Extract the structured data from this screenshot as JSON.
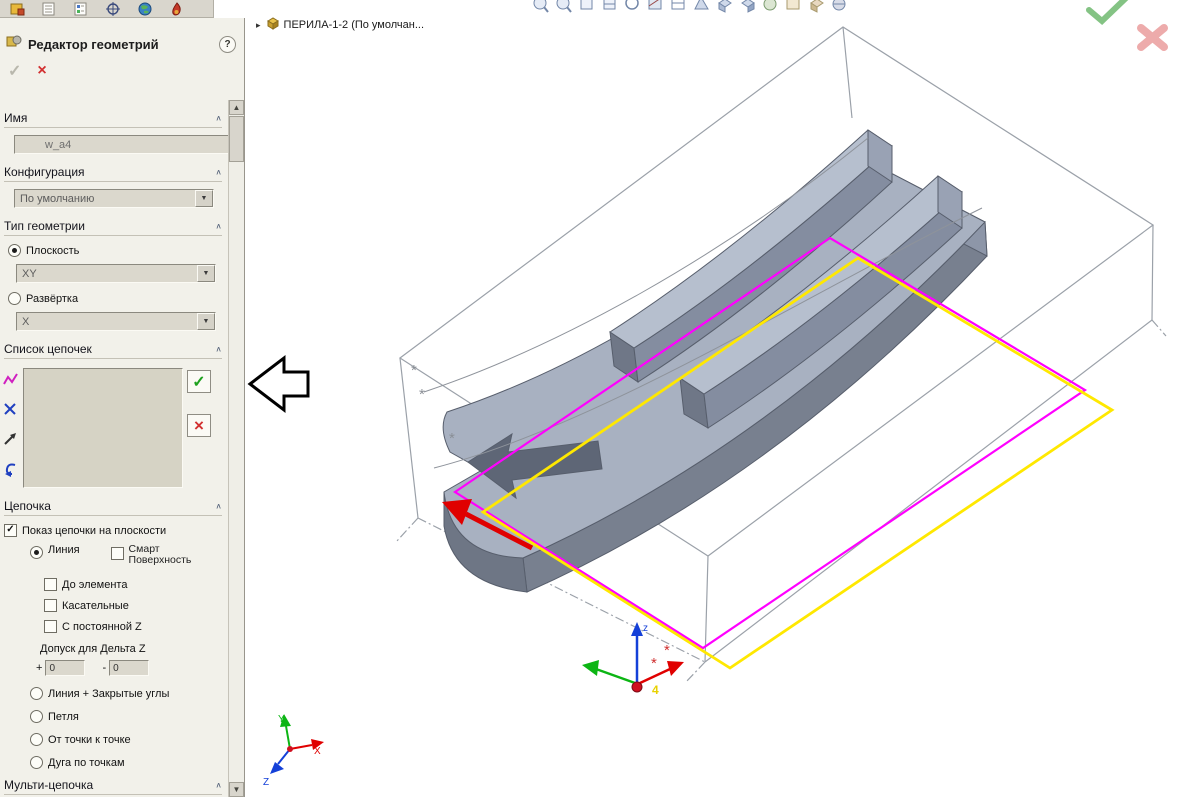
{
  "glyphs": {
    "check": "✓",
    "cross": "×",
    "chevron": "∧",
    "dropdown": "▼",
    "scroll_up": "▲",
    "scroll_down": "▼",
    "expander": "▸",
    "plus": "+",
    "minus": "-",
    "asterisk": "*",
    "help": "?"
  },
  "panel": {
    "title": "Редактор геометрий",
    "sections": {
      "name": {
        "header": "Имя",
        "value": "w_a4"
      },
      "config": {
        "header": "Конфигурация",
        "value": "По умолчанию"
      },
      "geom_type": {
        "header": "Тип геометрии",
        "plane_label": "Плоскость",
        "plane_value": "XY",
        "unfold_label": "Развёртка",
        "unfold_value": "X"
      },
      "chain_list": {
        "header": "Список цепочек"
      },
      "chain": {
        "header": "Цепочка",
        "show_on_plane": "Показ цепочки на плоскости",
        "line_label": "Линия",
        "smart_line1": "Смарт",
        "smart_line2": "Поверхность",
        "opt_to_element": "До элемента",
        "opt_tangent": "Касательные",
        "opt_const_z": "С постоянной Z",
        "tolerance_label": "Допуск для Дельта Z",
        "plus_value": "0",
        "minus_value": "0",
        "mode_line_corners": "Линия + Закрытые углы",
        "mode_loop": "Петля",
        "mode_point": "От точки к точке",
        "mode_arc": "Дуга по точкам"
      },
      "multi_chain": {
        "header": "Мульти-цепочка"
      }
    }
  },
  "viewport": {
    "breadcrumb": "ПЕРИЛА-1-2  (По умолчан...",
    "origin_triad_z": "z",
    "origin_index": "4",
    "triad_x": "X",
    "triad_y": "Y",
    "triad_z": "Z"
  },
  "colors": {
    "magenta_contour": "#ff00ff",
    "yellow_contour": "#ffe800",
    "model_fill": "#a8b1c1",
    "model_dark": "#78808f",
    "confirm_green": "#1fa11f",
    "cancel_red": "#d23030",
    "viewport_check_green": "#84c384",
    "viewport_close_pink": "#edabab"
  }
}
